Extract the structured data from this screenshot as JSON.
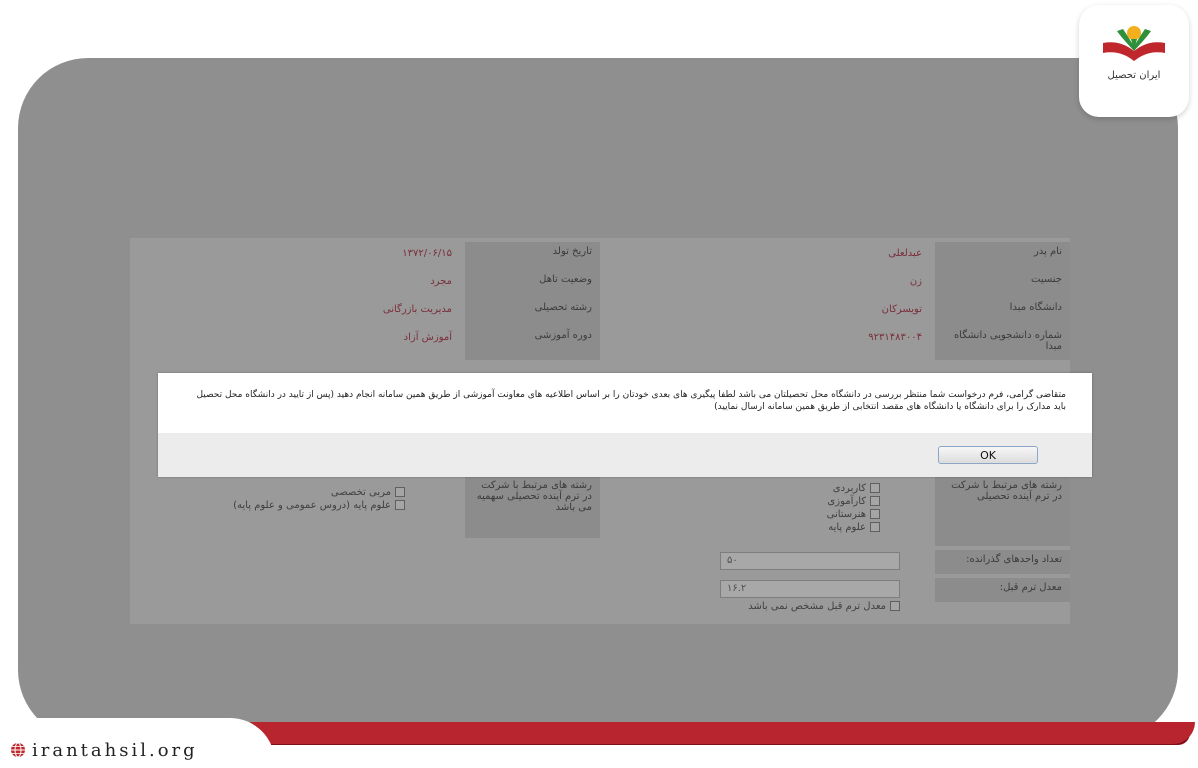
{
  "logo": {
    "text": "ایران تحصیل"
  },
  "site": {
    "url": "irantahsil.org"
  },
  "form": {
    "rows": [
      {
        "label": "نام پدر",
        "value": "عبدلعلی",
        "label2": "تاریخ تولد",
        "value2": "۱۳۷۲/۰۶/۱۵"
      },
      {
        "label": "جنسیت",
        "value": "زن",
        "label2": "وضعیت تاهل",
        "value2": "مجرد"
      },
      {
        "label": "دانشگاه مبدا",
        "value": "تویسرکان",
        "label2": "رشته تحصیلی",
        "value2": "مدیریت بازرگانی"
      },
      {
        "label": "شماره دانشجویی دانشگاه مبدا",
        "value": "۹۲۳۱۴۸۳۰۰۴",
        "label2": "دوره آموزشی",
        "value2": "آموزش آزاد"
      }
    ],
    "question_left": "رشته های مرتبط با شرکت در ترم آینده تحصیلی",
    "checkboxes_right": [
      "کاربردی",
      "کارآموزی",
      "هنرستانی",
      "علوم پایه"
    ],
    "question_mid": "رشته های مرتبط با شرکت در ترم آینده تحصیلی سهمیه می باشد",
    "checkboxes_left": [
      "مربی تخصصی",
      "علوم پایه (دروس عمومی و علوم پایه)"
    ],
    "units_label": "تعداد واحدهای گذرانده:",
    "units_value": "۵۰",
    "gpa_label": "معدل ترم قبل:",
    "gpa_value": "۱۶.۲",
    "gpa_check": "معدل ترم قبل مشخص نمی باشد"
  },
  "dialog": {
    "message": "متقاضی گرامی، فرم درخواست شما منتظر بررسی در دانشگاه محل تحصیلتان می باشد لطفا پیگیری های بعدی خودتان را بر اساس اطلاعیه های معاونت آموزشی از طریق همین سامانه انجام دهید (پس از تایید در دانشگاه محل تحصیل باید مدارک را برای دانشگاه یا دانشگاه های مقصد انتخابی از طریق همین سامانه ارسال نمایید)",
    "ok_label": "OK"
  }
}
